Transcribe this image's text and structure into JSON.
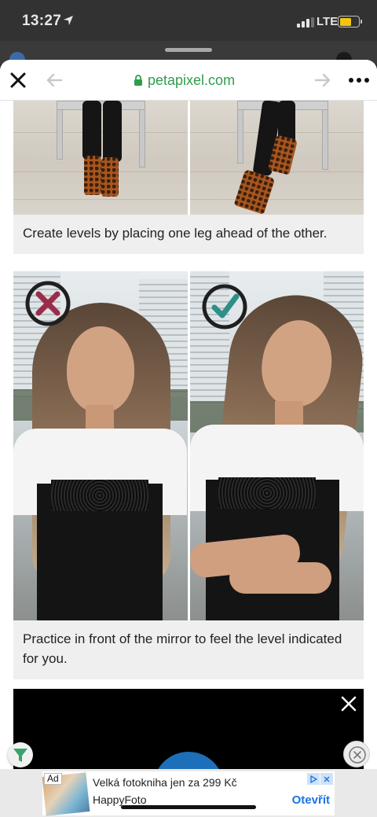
{
  "status_bar": {
    "time": "13:27",
    "network": "LTE",
    "icons": [
      "location-arrow-icon",
      "signal-bars-icon",
      "battery-charging-icon"
    ]
  },
  "browser": {
    "url": "petapixel.com",
    "icons": [
      "close-icon",
      "back-arrow-icon",
      "lock-icon",
      "forward-arrow-icon",
      "more-dots-icon"
    ],
    "url_color": "#2f9d4b"
  },
  "article": {
    "cards": [
      {
        "caption": "Create levels by placing one leg ahead of the other."
      },
      {
        "caption": "Practice in front of the mirror to feel the level indicated for you.",
        "left_badge": "cross-badge-icon",
        "right_badge": "check-badge-icon",
        "cross_color": "#9b2c4a",
        "check_color": "#2e8f87"
      }
    ]
  },
  "ad": {
    "tag": "Ad",
    "headline": "Velká fotokniha jen za 299 Kč",
    "brand": "HappyFoto",
    "cta": "Otevřít",
    "cta_color": "#1a73e8"
  }
}
